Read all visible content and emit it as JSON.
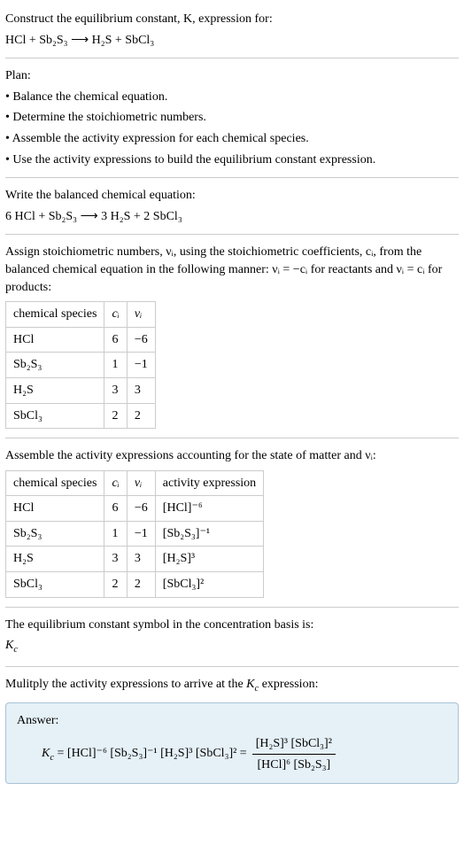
{
  "intro": {
    "line1": "Construct the equilibrium constant, K, expression for:",
    "equation_unbalanced": "HCl + Sb₂S₃ ⟶ H₂S + SbCl₃"
  },
  "plan": {
    "heading": "Plan:",
    "bullets": [
      "• Balance the chemical equation.",
      "• Determine the stoichiometric numbers.",
      "• Assemble the activity expression for each chemical species.",
      "• Use the activity expressions to build the equilibrium constant expression."
    ]
  },
  "balanced": {
    "heading": "Write the balanced chemical equation:",
    "equation_balanced": "6 HCl + Sb₂S₃ ⟶ 3 H₂S + 2 SbCl₃"
  },
  "stoich_intro": "Assign stoichiometric numbers, νᵢ, using the stoichiometric coefficients, cᵢ, from the balanced chemical equation in the following manner: νᵢ = −cᵢ for reactants and νᵢ = cᵢ for products:",
  "table1": {
    "headers": [
      "chemical species",
      "cᵢ",
      "νᵢ"
    ],
    "rows": [
      [
        "HCl",
        "6",
        "−6"
      ],
      [
        "Sb₂S₃",
        "1",
        "−1"
      ],
      [
        "H₂S",
        "3",
        "3"
      ],
      [
        "SbCl₃",
        "2",
        "2"
      ]
    ]
  },
  "activity_intro": "Assemble the activity expressions accounting for the state of matter and νᵢ:",
  "table2": {
    "headers": [
      "chemical species",
      "cᵢ",
      "νᵢ",
      "activity expression"
    ],
    "rows": [
      [
        "HCl",
        "6",
        "−6",
        "[HCl]⁻⁶"
      ],
      [
        "Sb₂S₃",
        "1",
        "−1",
        "[Sb₂S₃]⁻¹"
      ],
      [
        "H₂S",
        "3",
        "3",
        "[H₂S]³"
      ],
      [
        "SbCl₃",
        "2",
        "2",
        "[SbCl₃]²"
      ]
    ]
  },
  "basis": {
    "line1": "The equilibrium constant symbol in the concentration basis is:",
    "symbol": "K_c"
  },
  "multiply_intro": "Mulitply the activity expressions to arrive at the K_c expression:",
  "answer": {
    "label": "Answer:",
    "lhs": "K_c = [HCl]⁻⁶ [Sb₂S₃]⁻¹ [H₂S]³ [SbCl₃]² =",
    "num": "[H₂S]³ [SbCl₃]²",
    "den": "[HCl]⁶ [Sb₂S₃]"
  },
  "chart_data": {
    "type": "table",
    "species": [
      "HCl",
      "Sb₂S₃",
      "H₂S",
      "SbCl₃"
    ],
    "c_i": [
      6,
      1,
      3,
      2
    ],
    "nu_i": [
      -6,
      -1,
      3,
      2
    ],
    "activity_expressions": [
      "[HCl]⁻⁶",
      "[Sb₂S₃]⁻¹",
      "[H₂S]³",
      "[SbCl₃]²"
    ]
  },
  "answer_box_bg": "#e5f0f7",
  "answer_box_border": "#a9c2d4"
}
